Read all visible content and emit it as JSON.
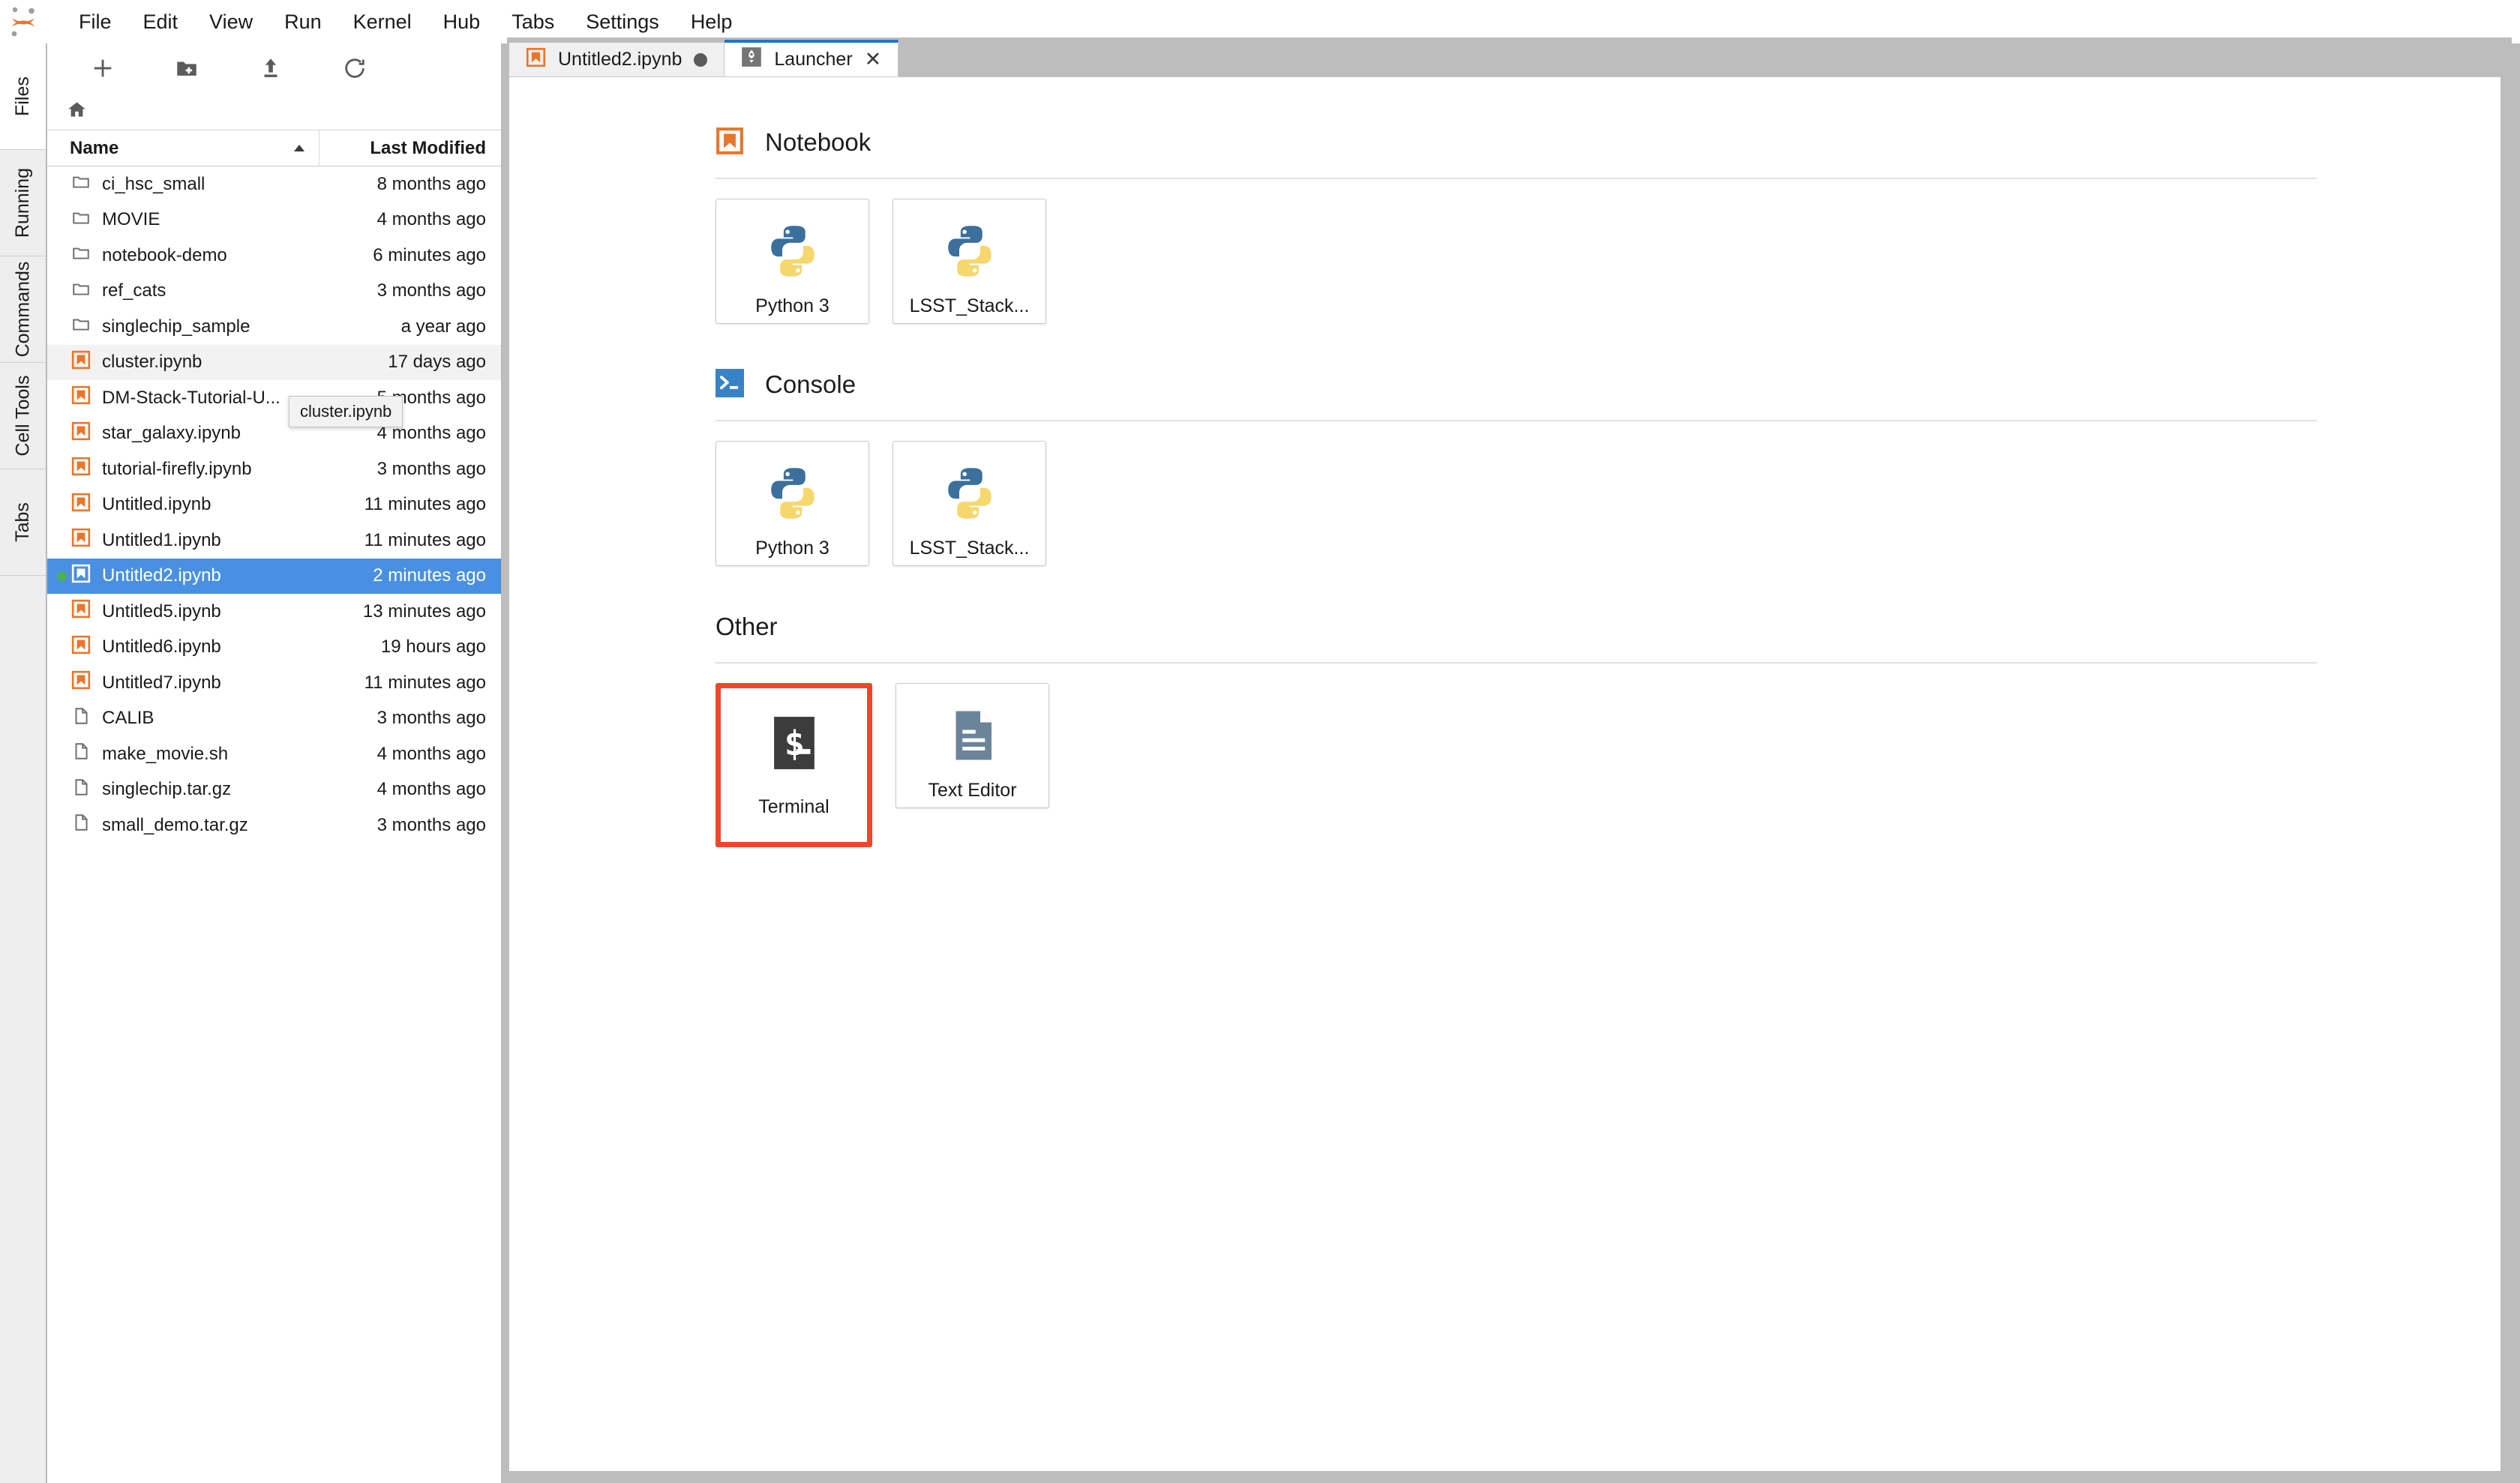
{
  "app": {
    "logo_icon": "jupyter-logo-icon"
  },
  "menubar": {
    "items": [
      {
        "label": "File"
      },
      {
        "label": "Edit"
      },
      {
        "label": "View"
      },
      {
        "label": "Run"
      },
      {
        "label": "Kernel"
      },
      {
        "label": "Hub"
      },
      {
        "label": "Tabs"
      },
      {
        "label": "Settings"
      },
      {
        "label": "Help"
      }
    ]
  },
  "sidebar": {
    "tabs": [
      {
        "label": "Files",
        "active": true
      },
      {
        "label": "Running",
        "active": false
      },
      {
        "label": "Commands",
        "active": false
      },
      {
        "label": "Cell Tools",
        "active": false
      },
      {
        "label": "Tabs",
        "active": false
      }
    ]
  },
  "filebrowser": {
    "toolbar": [
      {
        "name": "new-launcher-button",
        "icon": "plus-icon"
      },
      {
        "name": "new-folder-button",
        "icon": "new-folder-icon"
      },
      {
        "name": "upload-button",
        "icon": "upload-icon"
      },
      {
        "name": "refresh-button",
        "icon": "refresh-icon"
      }
    ],
    "breadcrumb_home_icon": "home-icon",
    "columns": {
      "name": "Name",
      "last_modified": "Last Modified",
      "sort_direction": "ascending"
    },
    "tooltip": "cluster.ipynb",
    "selected_colors": {
      "background": "#4a90e2",
      "text": "#ffffff"
    },
    "rows": [
      {
        "name": "ci_hsc_small",
        "modified": "8 months ago",
        "kind": "folder",
        "state": "normal"
      },
      {
        "name": "MOVIE",
        "modified": "4 months ago",
        "kind": "folder",
        "state": "normal"
      },
      {
        "name": "notebook-demo",
        "modified": "6 minutes ago",
        "kind": "folder",
        "state": "normal"
      },
      {
        "name": "ref_cats",
        "modified": "3 months ago",
        "kind": "folder",
        "state": "normal"
      },
      {
        "name": "singlechip_sample",
        "modified": "a year ago",
        "kind": "folder",
        "state": "normal"
      },
      {
        "name": "cluster.ipynb",
        "modified": "17 days ago",
        "kind": "notebook",
        "state": "hover"
      },
      {
        "name": "DM-Stack-Tutorial-U...",
        "modified": "5 months ago",
        "kind": "notebook",
        "state": "normal"
      },
      {
        "name": "star_galaxy.ipynb",
        "modified": "4 months ago",
        "kind": "notebook",
        "state": "normal"
      },
      {
        "name": "tutorial-firefly.ipynb",
        "modified": "3 months ago",
        "kind": "notebook",
        "state": "normal"
      },
      {
        "name": "Untitled.ipynb",
        "modified": "11 minutes ago",
        "kind": "notebook",
        "state": "normal"
      },
      {
        "name": "Untitled1.ipynb",
        "modified": "11 minutes ago",
        "kind": "notebook",
        "state": "normal"
      },
      {
        "name": "Untitled2.ipynb",
        "modified": "2 minutes ago",
        "kind": "notebook",
        "state": "selected",
        "running": true
      },
      {
        "name": "Untitled5.ipynb",
        "modified": "13 minutes ago",
        "kind": "notebook",
        "state": "normal"
      },
      {
        "name": "Untitled6.ipynb",
        "modified": "19 hours ago",
        "kind": "notebook",
        "state": "normal"
      },
      {
        "name": "Untitled7.ipynb",
        "modified": "11 minutes ago",
        "kind": "notebook",
        "state": "normal"
      },
      {
        "name": "CALIB",
        "modified": "3 months ago",
        "kind": "file",
        "state": "normal"
      },
      {
        "name": "make_movie.sh",
        "modified": "4 months ago",
        "kind": "file",
        "state": "normal"
      },
      {
        "name": "singlechip.tar.gz",
        "modified": "4 months ago",
        "kind": "file",
        "state": "normal"
      },
      {
        "name": "small_demo.tar.gz",
        "modified": "3 months ago",
        "kind": "file",
        "state": "normal"
      }
    ]
  },
  "dock": {
    "tabs": [
      {
        "label": "Untitled2.ipynb",
        "icon": "notebook-icon",
        "current": false,
        "dirty": true
      },
      {
        "label": "Launcher",
        "icon": "launcher-rocket-icon",
        "current": true,
        "dirty": false
      }
    ]
  },
  "launcher": {
    "sections": [
      {
        "title": "Notebook",
        "icon": "notebook-icon",
        "cards": [
          {
            "label": "Python 3",
            "icon": "python-icon",
            "annotated": false
          },
          {
            "label": "LSST_Stack...",
            "icon": "python-icon",
            "annotated": false
          }
        ]
      },
      {
        "title": "Console",
        "icon": "console-icon",
        "cards": [
          {
            "label": "Python 3",
            "icon": "python-icon",
            "annotated": false
          },
          {
            "label": "LSST_Stack...",
            "icon": "python-icon",
            "annotated": false
          }
        ]
      },
      {
        "title": "Other",
        "icon": "",
        "cards": [
          {
            "label": "Terminal",
            "icon": "terminal-icon",
            "annotated": true
          },
          {
            "label": "Text Editor",
            "icon": "text-editor-icon",
            "annotated": false
          }
        ]
      }
    ],
    "annotation_color": "#f0452b"
  }
}
